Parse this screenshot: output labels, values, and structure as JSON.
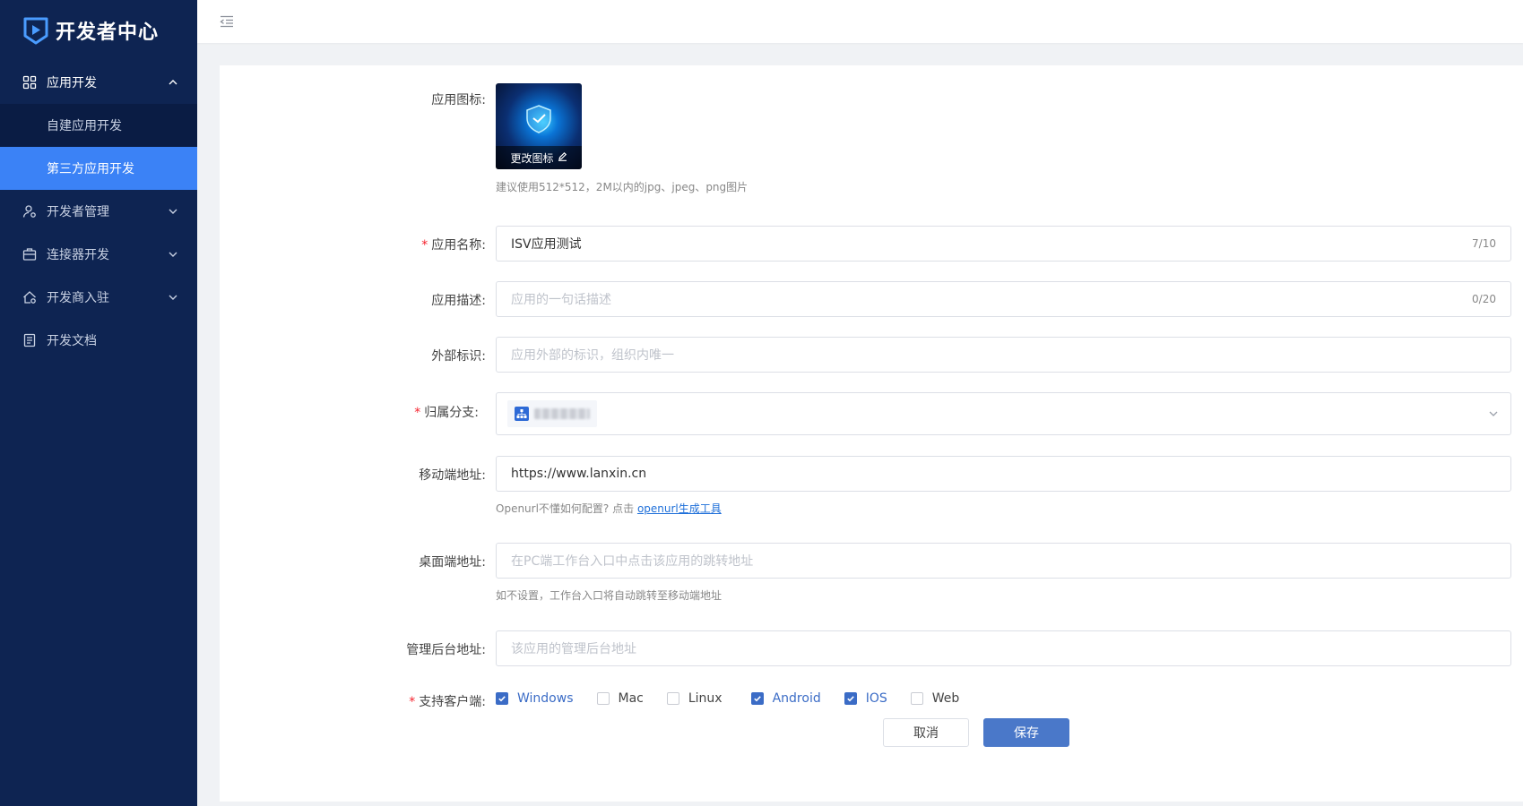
{
  "brand": {
    "title": "开发者中心"
  },
  "sidebar": {
    "items": [
      {
        "label": "应用开发",
        "icon": "grid-icon",
        "open": true
      },
      {
        "label": "开发者管理",
        "icon": "user-gear-icon"
      },
      {
        "label": "连接器开发",
        "icon": "briefcase-icon"
      },
      {
        "label": "开发商入驻",
        "icon": "home-gear-icon"
      },
      {
        "label": "开发文档",
        "icon": "document-icon"
      }
    ],
    "sub_items": [
      {
        "label": "自建应用开发"
      },
      {
        "label": "第三方应用开发",
        "active": true
      }
    ]
  },
  "form": {
    "app_icon": {
      "label": "应用图标:",
      "change_label": "更改图标",
      "hint": "建议使用512*512，2M以内的jpg、jpeg、png图片"
    },
    "app_name": {
      "label": "应用名称:",
      "value": "ISV应用测试",
      "count": "7/10",
      "required": "*"
    },
    "app_desc": {
      "label": "应用描述:",
      "placeholder": "应用的一句话描述",
      "count": "0/20"
    },
    "external_id": {
      "label": "外部标识:",
      "placeholder": "应用外部的标识，组织内唯一"
    },
    "branch": {
      "label": "归属分支:",
      "required": "*"
    },
    "mobile_url": {
      "label": "移动端地址:",
      "value": "https://www.lanxin.cn",
      "hint_prefix": "Openurl不懂如何配置? 点击",
      "hint_link": "openurl生成工具"
    },
    "desktop_url": {
      "label": "桌面端地址:",
      "placeholder": "在PC端工作台入口中点击该应用的跳转地址",
      "hint": "如不设置，工作台入口将自动跳转至移动端地址"
    },
    "admin_url": {
      "label": "管理后台地址:",
      "placeholder": "该应用的管理后台地址"
    },
    "clients": {
      "label": "支持客户端:",
      "required": "*",
      "options": [
        {
          "label": "Windows",
          "checked": true
        },
        {
          "label": "Mac",
          "checked": false
        },
        {
          "label": "Linux",
          "checked": false
        },
        {
          "label": "Android",
          "checked": true
        },
        {
          "label": "IOS",
          "checked": true
        },
        {
          "label": "Web",
          "checked": false
        }
      ]
    },
    "buttons": {
      "cancel": "取消",
      "save": "保存"
    }
  },
  "colors": {
    "sidebar_bg": "#0e2452",
    "active": "#3b82f6",
    "primary": "#4a78c9",
    "required": "#f5222d"
  }
}
